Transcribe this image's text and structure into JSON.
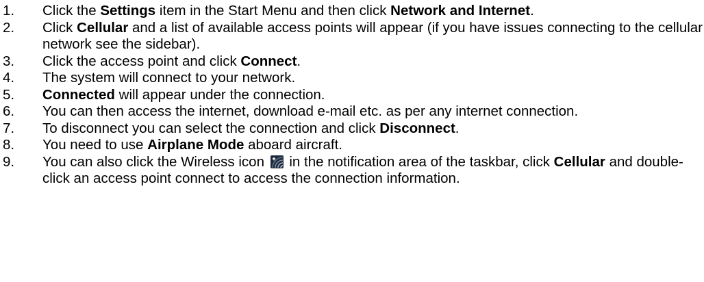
{
  "steps": [
    {
      "num": "1.",
      "segments": [
        {
          "text": "Click the ",
          "bold": false
        },
        {
          "text": "Settings",
          "bold": true
        },
        {
          "text": " item in the Start Menu and then click ",
          "bold": false
        },
        {
          "text": "Network and Internet",
          "bold": true
        },
        {
          "text": ".",
          "bold": false
        }
      ]
    },
    {
      "num": "2.",
      "segments": [
        {
          "text": "Click ",
          "bold": false
        },
        {
          "text": "Cellular",
          "bold": true
        },
        {
          "text": " and a list of available access points will appear (if you have issues connecting to the cellular network see the sidebar).",
          "bold": false
        }
      ]
    },
    {
      "num": "3.",
      "segments": [
        {
          "text": "Click the access point and click ",
          "bold": false
        },
        {
          "text": "Connect",
          "bold": true
        },
        {
          "text": ".",
          "bold": false
        }
      ]
    },
    {
      "num": "4.",
      "segments": [
        {
          "text": "The system will connect to your network.",
          "bold": false
        }
      ]
    },
    {
      "num": "5.",
      "segments": [
        {
          "text": "Connected",
          "bold": true
        },
        {
          "text": " will appear under the connection.",
          "bold": false
        }
      ]
    },
    {
      "num": "6.",
      "segments": [
        {
          "text": "You can then access the internet, download e-mail etc. as per any internet connection.",
          "bold": false
        }
      ]
    },
    {
      "num": "7.",
      "segments": [
        {
          "text": "To disconnect you can select the connection and click ",
          "bold": false
        },
        {
          "text": "Disconnect",
          "bold": true
        },
        {
          "text": ".",
          "bold": false
        }
      ]
    },
    {
      "num": "8.",
      "segments": [
        {
          "text": "You need to use ",
          "bold": false
        },
        {
          "text": "Airplane Mode",
          "bold": true
        },
        {
          "text": " aboard aircraft.",
          "bold": false
        }
      ]
    },
    {
      "num": "9.",
      "segments": [
        {
          "text": "You can also click the Wireless icon ",
          "bold": false
        },
        {
          "icon": "wireless-icon"
        },
        {
          "text": " in the notification area of the taskbar, click ",
          "bold": false
        },
        {
          "text": "Cellular",
          "bold": true
        },
        {
          "text": " and double-click an access point connect to access the connection information.",
          "bold": false
        }
      ]
    }
  ]
}
